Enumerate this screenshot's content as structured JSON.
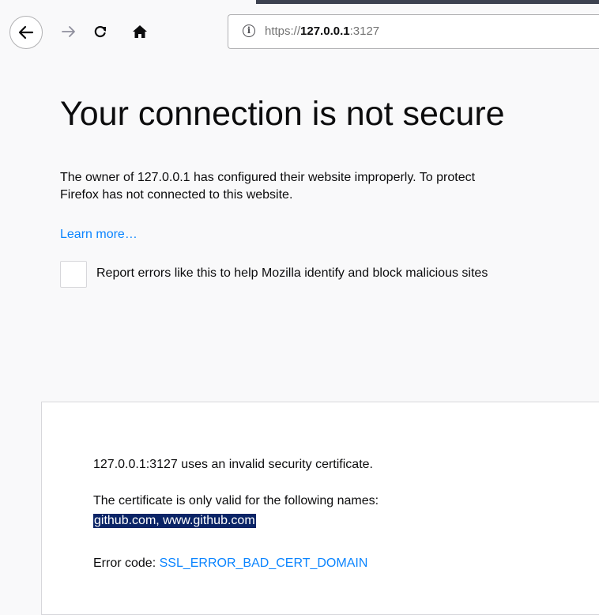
{
  "browser": {
    "url_scheme": "https://",
    "url_host": "127.0.0.1",
    "url_port": ":3127",
    "icons": {
      "back": "arrow-left-icon",
      "forward": "arrow-right-icon",
      "reload": "reload-icon",
      "home": "home-icon",
      "site_info": "info-icon"
    }
  },
  "error_page": {
    "title": "Your connection is not secure",
    "intro_line1": "The owner of 127.0.0.1 has configured their website improperly. To protect",
    "intro_line2": "Firefox has not connected to this website.",
    "learn_more": "Learn more…",
    "report_label": "Report errors like this to help Mozilla identify and block malicious sites"
  },
  "advanced": {
    "invalid_cert": "127.0.0.1:3127 uses an invalid security certificate.",
    "valid_names_intro": "The certificate is only valid for the following names:",
    "valid_names": "github.com, www.github.com",
    "error_code_label": "Error code: ",
    "error_code": "SSL_ERROR_BAD_CERT_DOMAIN"
  },
  "colors": {
    "link": "#0a84ff",
    "selection": "#0a2466",
    "page_bg": "#f9f9fa"
  }
}
